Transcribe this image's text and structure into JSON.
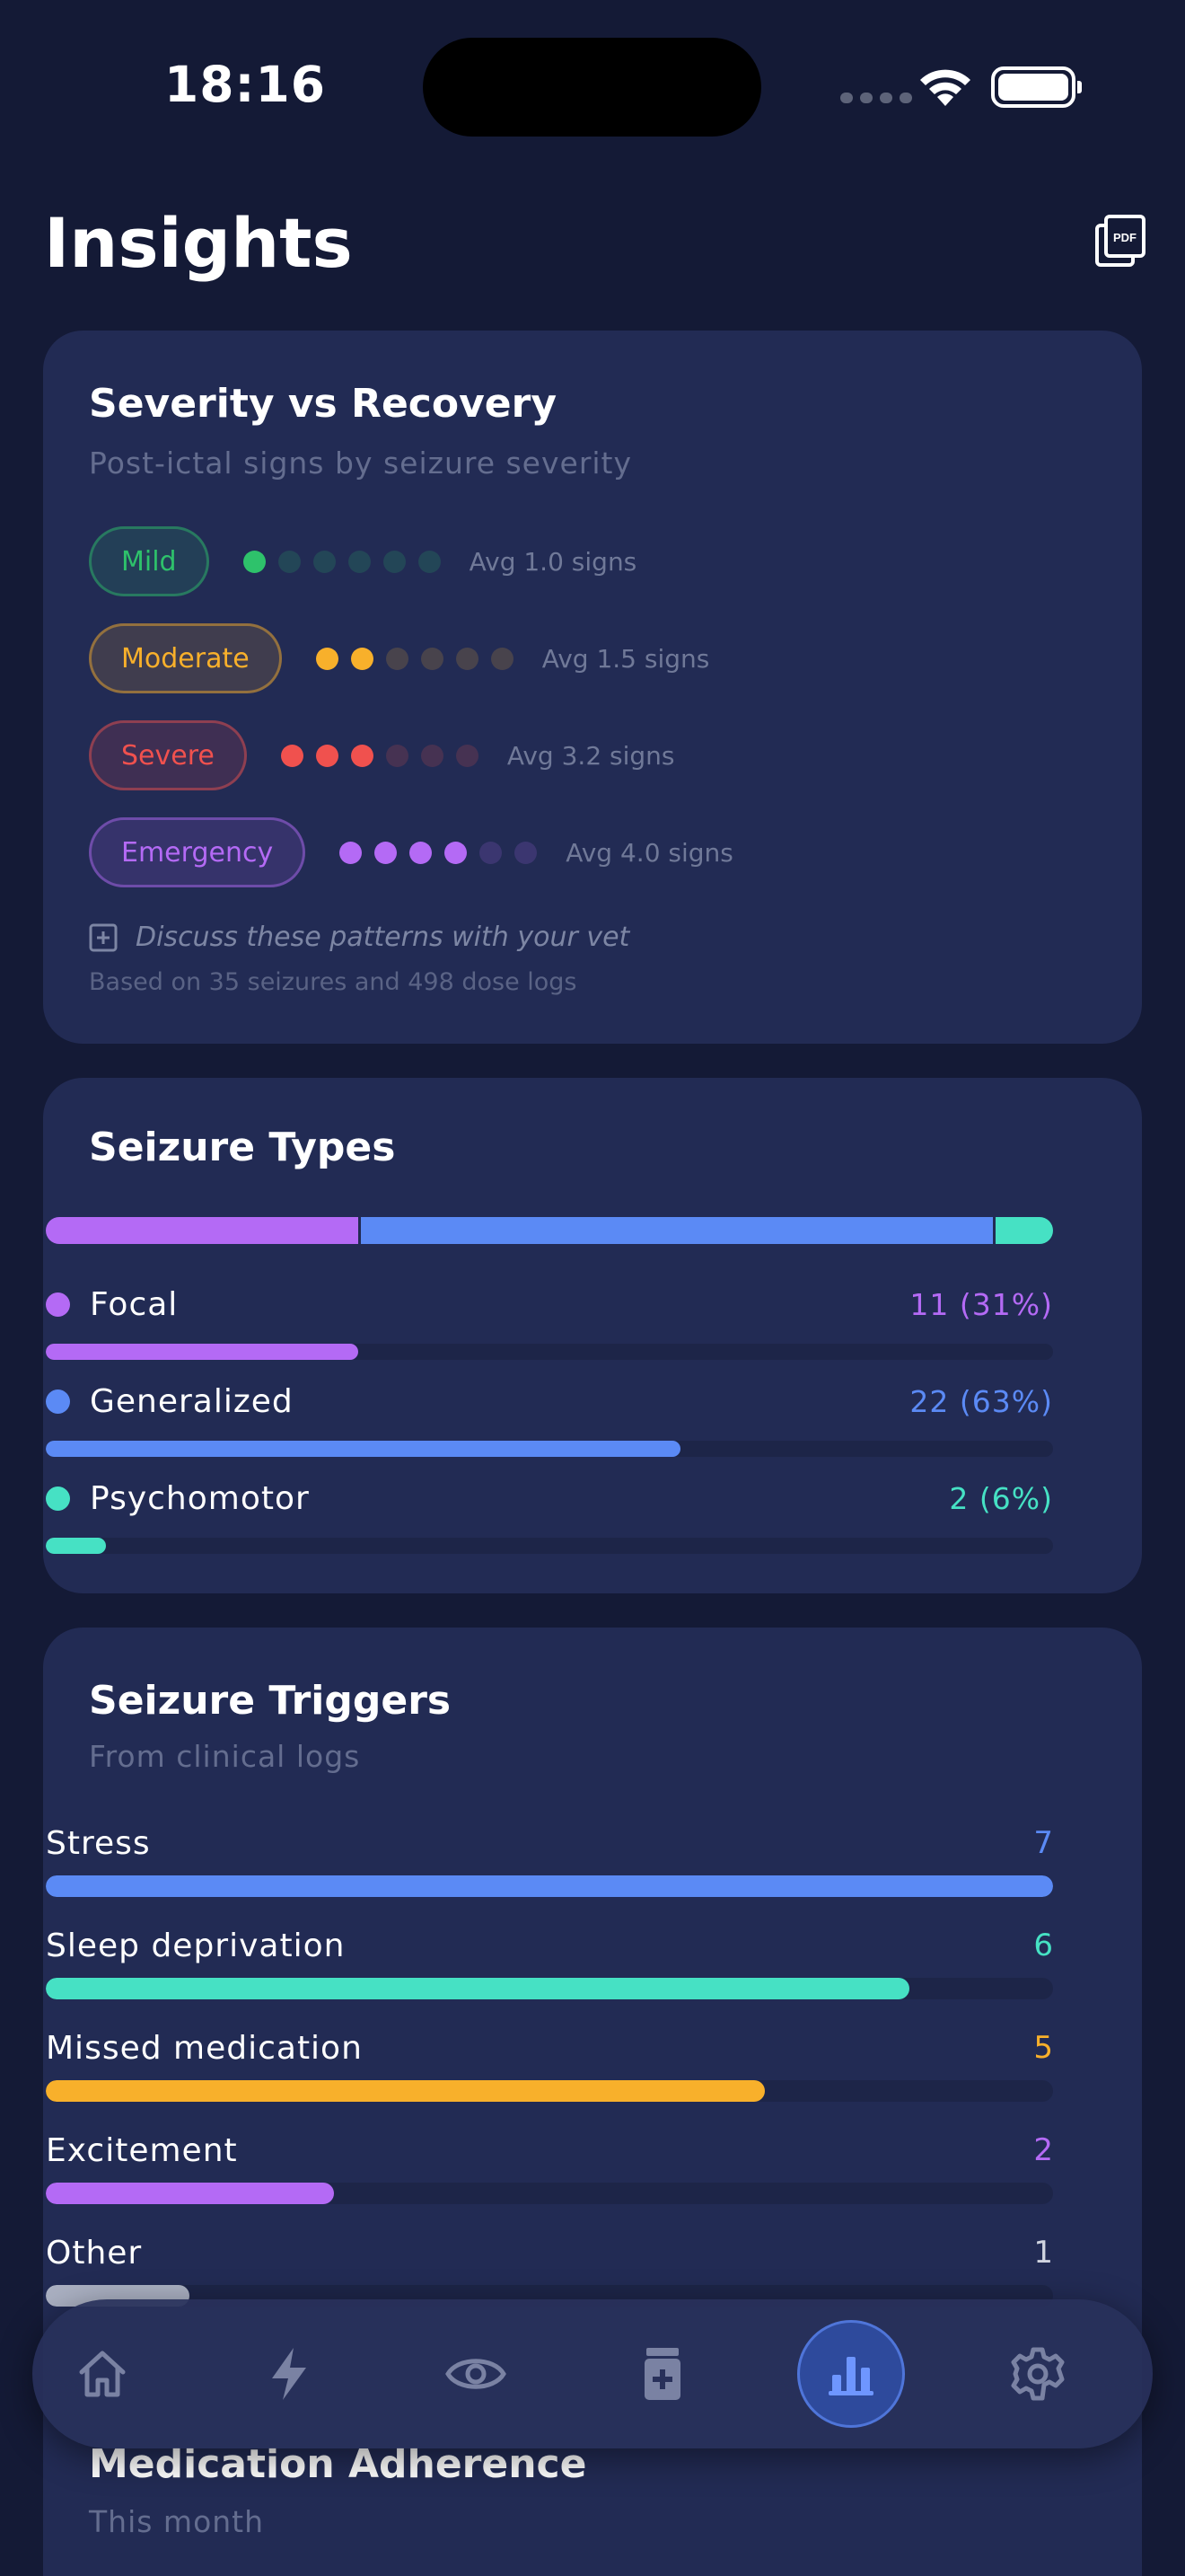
{
  "status_bar": {
    "time": "18:16"
  },
  "header": {
    "title": "Insights",
    "pdf_icon": "pdf-export-icon",
    "pdf_text": "PDF"
  },
  "severity_card": {
    "title": "Severity vs Recovery",
    "subtitle": "Post-ictal signs by seizure severity",
    "rows": [
      {
        "label": "Mild",
        "filled": 1,
        "total": 6,
        "avg": "Avg 1.0 signs",
        "color": "#2ec26b"
      },
      {
        "label": "Moderate",
        "filled": 2,
        "total": 6,
        "avg": "Avg 1.5 signs",
        "color": "#f8b02b"
      },
      {
        "label": "Severe",
        "filled": 3,
        "total": 6,
        "avg": "Avg 3.2 signs",
        "color": "#f0514e"
      },
      {
        "label": "Emergency",
        "filled": 4,
        "total": 6,
        "avg": "Avg 4.0 signs",
        "color": "#b46af5"
      }
    ],
    "vet_note": "Discuss these patterns with your vet",
    "based_on": "Based on 35 seizures and 498 dose logs"
  },
  "types_card": {
    "title": "Seizure Types",
    "items": [
      {
        "label": "Focal",
        "value": "11 (31%)",
        "fraction": 0.31,
        "color": "#b46af5"
      },
      {
        "label": "Generalized",
        "value": "22 (63%)",
        "fraction": 0.63,
        "color": "#5b8af5"
      },
      {
        "label": "Psychomotor",
        "value": "2 (6%)",
        "fraction": 0.06,
        "color": "#46e1c4"
      }
    ]
  },
  "triggers_card": {
    "title": "Seizure Triggers",
    "subtitle": "From clinical logs",
    "items": [
      {
        "label": "Stress",
        "value": "7",
        "count": 7,
        "color": "#5b8af5"
      },
      {
        "label": "Sleep deprivation",
        "value": "6",
        "count": 6,
        "color": "#46e1c4"
      },
      {
        "label": "Missed medication",
        "value": "5",
        "count": 5,
        "color": "#f8b02b"
      },
      {
        "label": "Excitement",
        "value": "2",
        "count": 2,
        "color": "#b46af5"
      },
      {
        "label": "Other",
        "value": "1",
        "count": 1,
        "color": "#aab0c2"
      }
    ]
  },
  "adherence_card": {
    "title": "Medication Adherence",
    "subtitle": "This month"
  },
  "nav": {
    "items": [
      {
        "icon": "home-icon",
        "active": false
      },
      {
        "icon": "lightning-icon",
        "active": false
      },
      {
        "icon": "eye-icon",
        "active": false
      },
      {
        "icon": "medication-icon",
        "active": false
      },
      {
        "icon": "bar-chart-icon",
        "active": true
      },
      {
        "icon": "gear-icon",
        "active": false
      }
    ]
  }
}
